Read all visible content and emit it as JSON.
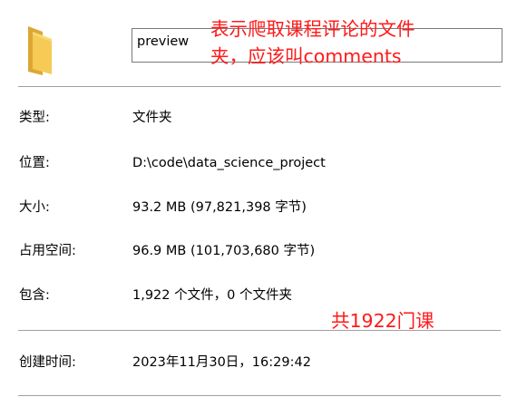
{
  "name_field": {
    "value": "preview"
  },
  "properties": [
    {
      "label": "类型:",
      "value": "文件夹"
    },
    {
      "label": "位置:",
      "value": "D:\\code\\data_science_project"
    },
    {
      "label": "大小:",
      "value": "93.2 MB (97,821,398 字节)"
    },
    {
      "label": "占用空间:",
      "value": "96.9 MB (101,703,680 字节)"
    },
    {
      "label": "包含:",
      "value": "1,922 个文件，0 个文件夹"
    },
    {
      "label": "创建时间:",
      "value": "2023年11月30日，16:29:42"
    }
  ],
  "annotations": {
    "name_note_line1": "表示爬取课程评论的文件",
    "name_note_line2": "夹，应该叫comments",
    "count_note": "共1922门课"
  },
  "colors": {
    "annotation": "#ff1a1a",
    "folder": "#f3c44d",
    "divider": "#a0a0a0"
  },
  "icons": {
    "folder": "folder-icon"
  }
}
